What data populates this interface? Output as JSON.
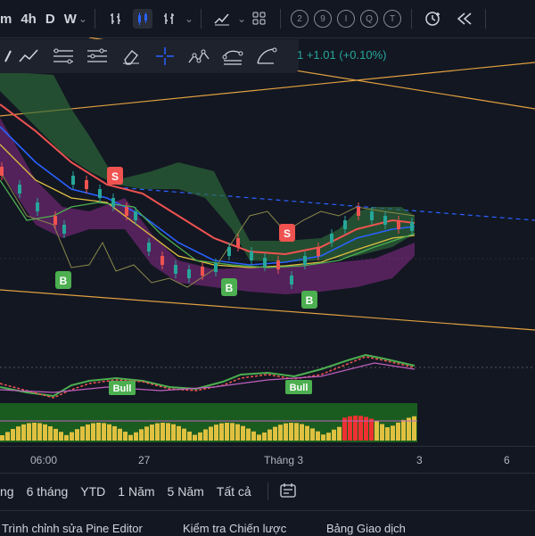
{
  "toolbar": {
    "timeframe_m": "m",
    "timeframe_4h": "4h",
    "timeframe_d": "D",
    "timeframe_w": "W",
    "circle_icons": [
      "2",
      "9",
      "I",
      "Q",
      "T"
    ]
  },
  "legend": {
    "change": "1  +1.01 (+0.10%)"
  },
  "signals": {
    "sell": "S",
    "buy": "B",
    "bull": "Bull"
  },
  "time_axis": {
    "t1": "06:00",
    "t2": "27",
    "t3": "Tháng 3",
    "t4": "3",
    "t5": "6"
  },
  "range_bar": {
    "r1": "ng",
    "r2": "6 tháng",
    "r3": "YTD",
    "r4": "1 Năm",
    "r5": "5 Năm",
    "r6": "Tất cả"
  },
  "bottom_bar": {
    "b1": "Trình chỉnh sửa Pine Editor",
    "b2": "Kiểm tra Chiến lược",
    "b3": "Bảng Giao dịch"
  },
  "colors": {
    "background": "#131722",
    "accent_green": "#26a69a",
    "signal_red": "#ef5350",
    "signal_green": "#4caf50",
    "trend_orange": "#e0a040",
    "ma_blue": "#2962ff"
  }
}
